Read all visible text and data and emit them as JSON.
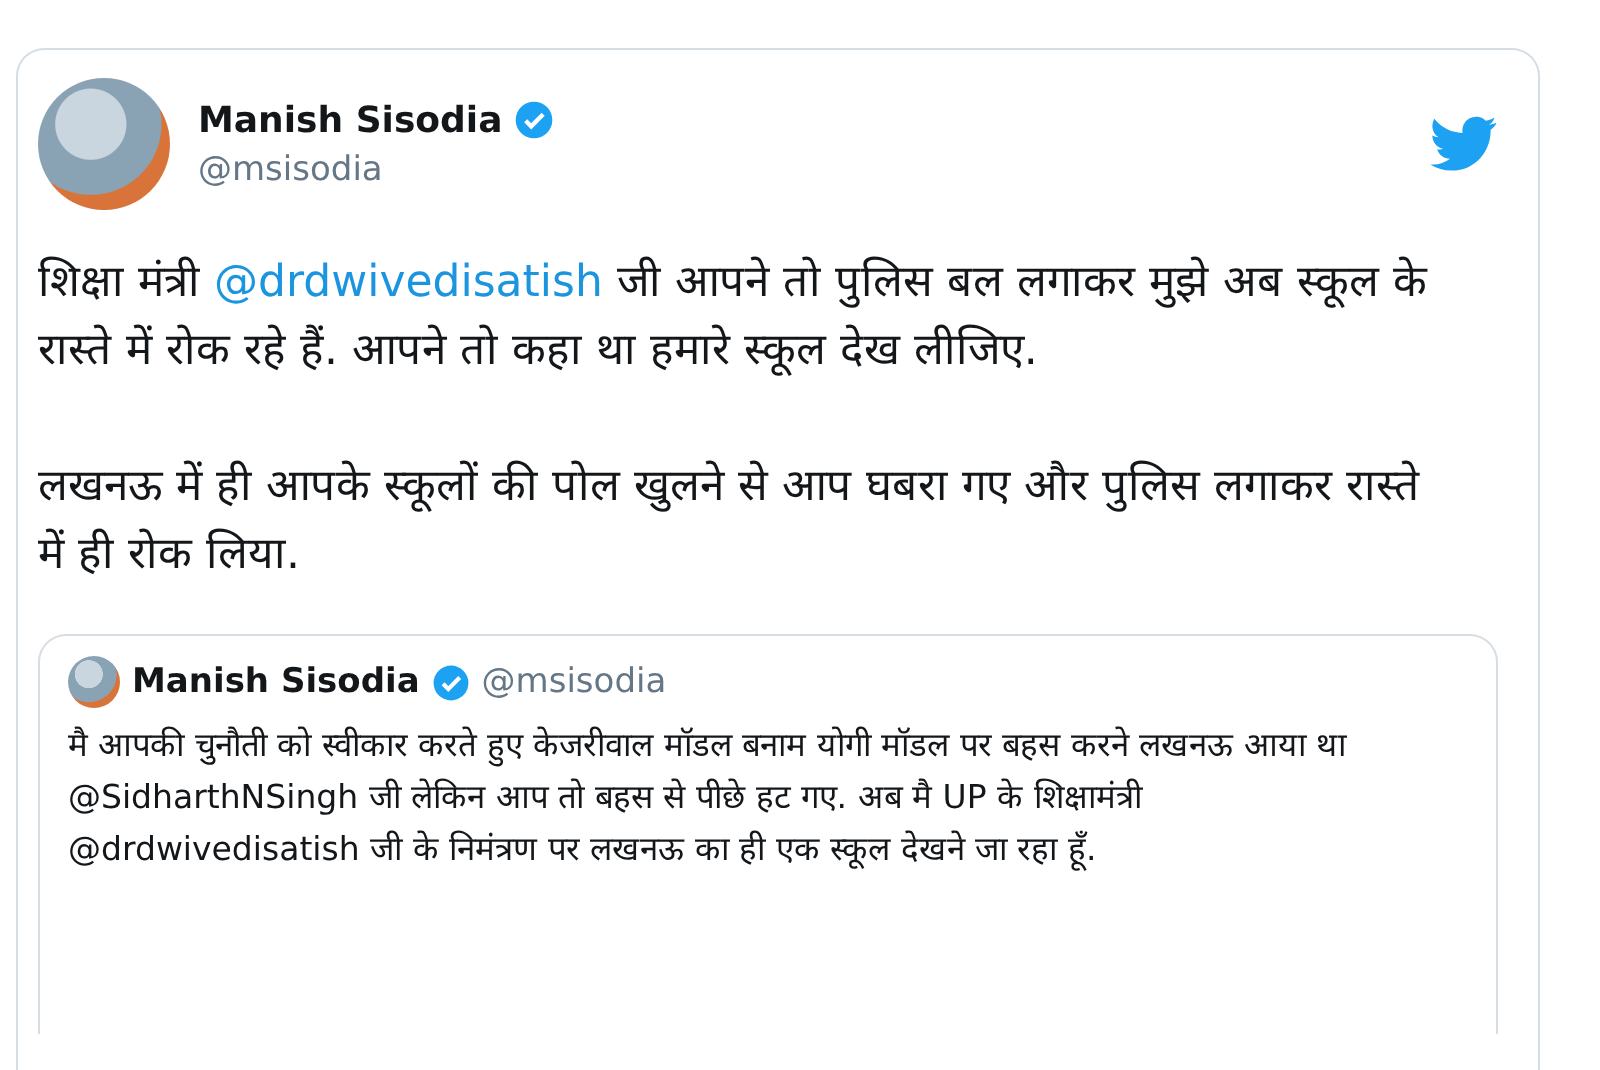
{
  "tweet": {
    "author": {
      "name": "Manish Sisodia",
      "verified": true,
      "handle": "@msisodia"
    },
    "paragraphs": [
      [
        {
          "kind": "text",
          "text": "शिक्षा मंत्री "
        },
        {
          "kind": "mention",
          "text": "@drdwivedisatish"
        },
        {
          "kind": "text",
          "text": " जी आपने तो पुलिस बल लगाकर मुझे अब स्कूल के रास्ते में रोक रहे हैं. आपने तो कहा था हमारे स्कूल देख लीजिए."
        }
      ],
      [
        {
          "kind": "text",
          "text": "लखनऊ में ही आपके स्कूलों की पोल खुलने से आप घबरा गए और पुलिस लगाकर रास्ते में ही रोक लिया."
        }
      ]
    ],
    "quote": {
      "author": {
        "name": "Manish Sisodia",
        "verified": true,
        "handle": "@msisodia"
      },
      "text": "मै आपकी चुनौती को स्वीकार करते हुए केजरीवाल मॉडल बनाम योगी मॉडल पर बहस करने लखनऊ आया था @SidharthNSingh जी लेकिन आप तो बहस से पीछे हट गए. अब मै UP के शिक्षामंत्री @drdwivedisatish जी के निमंत्रण पर लखनऊ का ही एक स्कूल देखने जा रहा हूँ."
    }
  }
}
